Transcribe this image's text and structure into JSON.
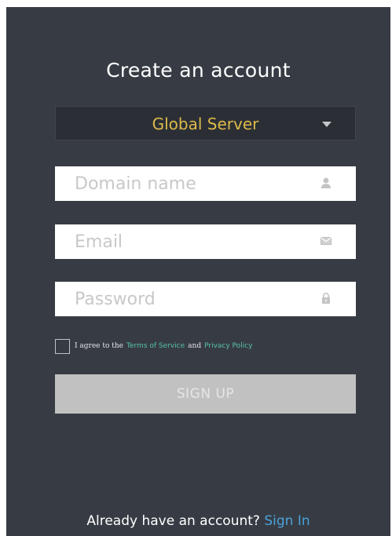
{
  "form": {
    "title": "Create an account",
    "server_select": {
      "label": "Global Server"
    },
    "domain": {
      "placeholder": "Domain name",
      "icon": "user-icon"
    },
    "email": {
      "placeholder": "Email",
      "icon": "envelope-icon"
    },
    "password": {
      "placeholder": "Password",
      "icon": "lock-icon"
    },
    "agree": {
      "prefix": "I agree to the",
      "terms": "Terms of Service",
      "and": "and",
      "privacy": "Privacy Policy"
    },
    "signup_label": "SIGN UP"
  },
  "footer": {
    "text": "Already have an account?",
    "signin": "Sign In"
  },
  "colors": {
    "panel": "#373c44",
    "select_bg": "#2b2f35",
    "select_text": "#ddb94a",
    "link_green": "#58c2a6",
    "link_blue": "#4aa2d9",
    "button_disabled": "#c1c1c1"
  }
}
